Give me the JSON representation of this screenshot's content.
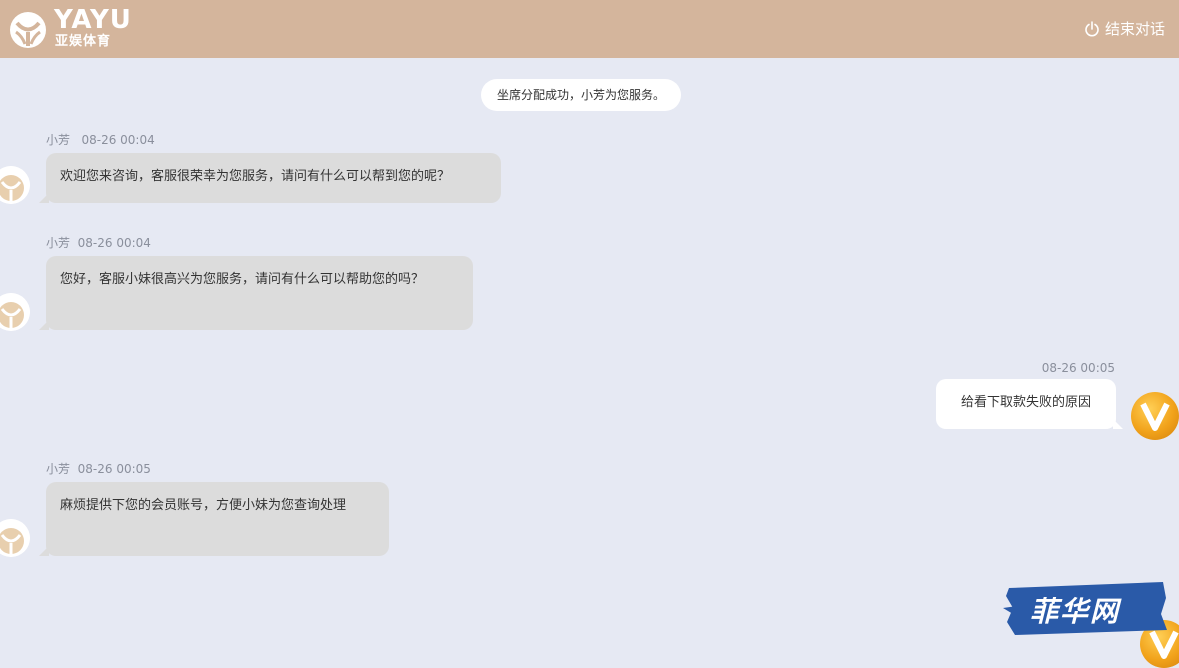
{
  "header": {
    "logo_word": "YAYU",
    "logo_sub": "亚娱体育",
    "end_chat_label": "结束对话",
    "background": "#d4b59c"
  },
  "system_notice": "坐席分配成功，小芳为您服务。",
  "messages": [
    {
      "sender": "agent",
      "name": "小芳",
      "time": "08-26 00:04",
      "text": "欢迎您来咨询，客服很荣幸为您服务，请问有什么可以帮到您的呢？"
    },
    {
      "sender": "agent",
      "name": "小芳",
      "time": "08-26 00:04",
      "text": "您好，客服小妹很高兴为您服务，请问有什么可以帮助您的吗？"
    },
    {
      "sender": "user",
      "name": "",
      "time": "08-26 00:05",
      "text": "给看下取款失败的原因"
    },
    {
      "sender": "agent",
      "name": "小芳",
      "time": "08-26 00:05",
      "text": "麻烦提供下您的会员账号，方便小妹为您查询处理"
    }
  ],
  "watermark": {
    "text": "菲华网",
    "color": "#2a5aa8"
  },
  "icons": {
    "power": "power-icon",
    "agent_avatar": "agent-avatar-icon",
    "user_avatar": "user-avatar-icon"
  }
}
